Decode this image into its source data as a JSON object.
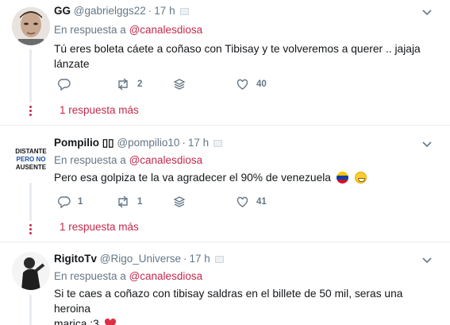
{
  "colors": {
    "accent": "#c22a4c",
    "muted": "#657786",
    "divider": "#e6ecf0"
  },
  "tweets": [
    {
      "name": "GG",
      "handle": "@gabrielggs22",
      "time": "17 h",
      "reply_prefix": "En respuesta a",
      "reply_mention": "@canalesdiosa",
      "text_line1": "Tú eres boleta cáete a coñaso con Tibisay y te volveremos a querer .. jajaja",
      "text_line2": "lánzate",
      "replies": "",
      "retweets": "2",
      "likes": "40",
      "more_replies": "1 respuesta más"
    },
    {
      "name": "Pompilio ▯▯",
      "handle": "@pompilio10",
      "time": "17 h",
      "reply_prefix": "En respuesta a",
      "reply_mention": "@canalesdiosa",
      "text_line1": "Pero esa golpiza te la va agradecer el 90% de venezuela",
      "replies": "1",
      "retweets": "1",
      "likes": "41",
      "more_replies": "1 respuesta más",
      "avatar_text": [
        "DISTANTE",
        "PERO NO",
        "AUSENTE"
      ]
    },
    {
      "name": "RigitoTv",
      "handle": "@Rigo_Universe",
      "time": "17 h",
      "reply_prefix": "En respuesta a",
      "reply_mention": "@canalesdiosa",
      "text_line1": "Si te caes a coñazo con tibisay saldras en el billete de 50 mil, seras una heroina",
      "text_line2": "marica :3"
    }
  ]
}
